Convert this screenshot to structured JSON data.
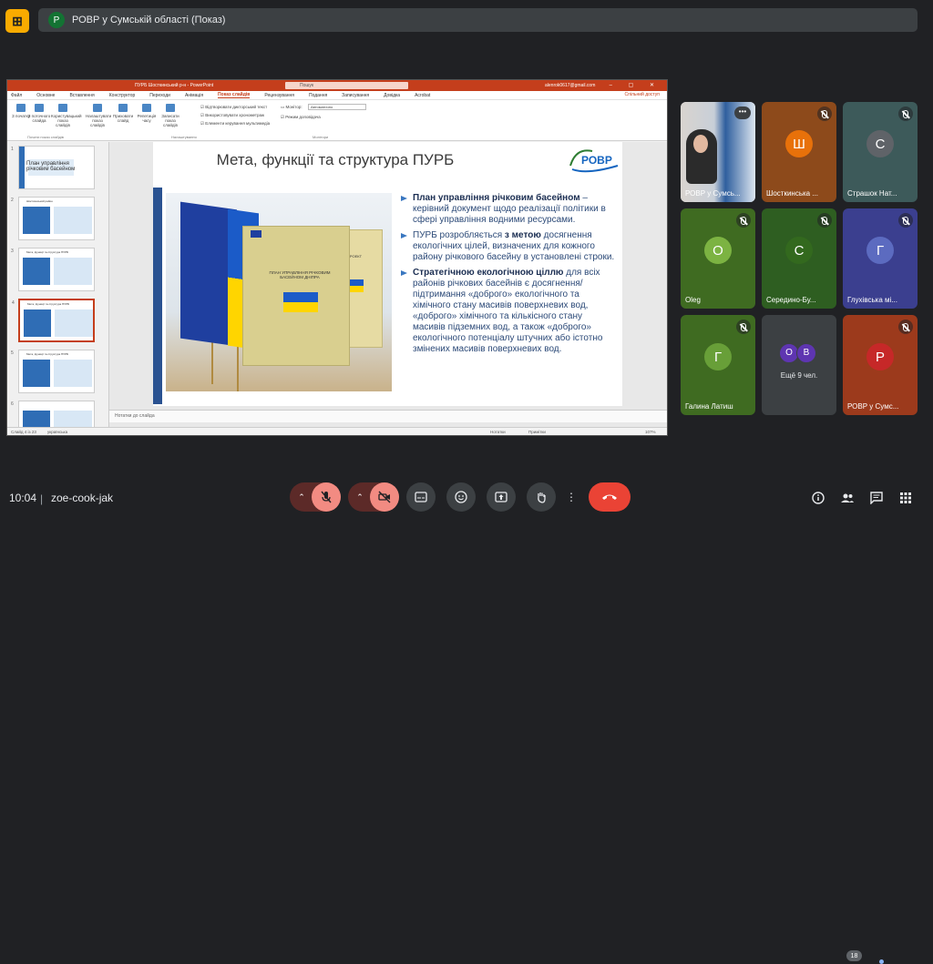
{
  "meeting": {
    "title": "РОВР у Сумській області (Показ)",
    "presenter_initial": "Р",
    "time": "10:04",
    "separator": "|",
    "code": "zoe-cook-jak",
    "participant_count": "18"
  },
  "powerpoint": {
    "doc_title": "ПУРБ Шосткинський р-н - PowerPoint",
    "search_placeholder": "Пошук",
    "user": "alenrok0617@gmail.com",
    "window_controls": "– ▢ ✕",
    "menu": [
      "Файл",
      "Основне",
      "Вставлення",
      "Конструктор",
      "Переходи",
      "Анімація",
      "Показ слайдів",
      "Рецензування",
      "Подання",
      "Записування",
      "Довідка",
      "Acrobat"
    ],
    "active_menu_index": 6,
    "share": "Спільний доступ",
    "ribbon": {
      "buttons": [
        "З початку",
        "З поточного слайда",
        "Користувацький показ слайдів",
        "Налаштувати показ слайдів",
        "Приховати слайд",
        "Репетиція часу",
        "Записати показ слайдів"
      ],
      "checks": [
        "Відтворювати дикторський текст",
        "Використовувати хронометраж",
        "Елементи керування мультимедіа"
      ],
      "monitor_label": "Монітор:",
      "monitor_value": "Автоматично",
      "presenter_view": "Режим доповідача",
      "groups": [
        "Почати показ слайдів",
        "Налаштування",
        "Монітори"
      ]
    },
    "thumbnails": [
      {
        "num": "1",
        "title": "План управління річковим басейном"
      },
      {
        "num": "2",
        "title": "Шосткинський район"
      },
      {
        "num": "3",
        "title": "Мета, функції та структура ПУРБ"
      },
      {
        "num": "4",
        "title": "Мета, функції та структура ПУРБ"
      },
      {
        "num": "5",
        "title": "Мета, функції та структура ПУРБ"
      },
      {
        "num": "6",
        "title": ""
      }
    ],
    "selected_thumbnail": 3,
    "notes": "Нотатки до слайда",
    "status": {
      "slide": "Слайд 4 із 23",
      "lang": "українська",
      "notes_btn": "Нотатки",
      "comments_btn": "Примітки",
      "zoom": "107%"
    }
  },
  "slide": {
    "title": "Мета, функції та структура ПУРБ",
    "logo_text": "РОВР",
    "logo_sub": "у Сумській області",
    "book_caption": "ПЛАН УПРАВЛІННЯ РІЧКОВИМ БАСЕЙНОМ ДНІПРА",
    "book2_caption": "ПРОЕКТ",
    "bullets": [
      {
        "bold": "План управління річковим басейном",
        "text": " – керівний документ щодо реалізації політики в сфері управління водними ресурсами."
      },
      {
        "pre": "ПУРБ розробляється ",
        "bold": "з метою",
        "text": " досягнення екологічних цілей, визначених для кожного району річкового басейну в установлені строки."
      },
      {
        "bold": "Стратегічною екологічною ціллю",
        "text": " для всіх районів річкових басейнів є досягнення/підтримання «доброго» екологічного та хімічного стану масивів поверхневих вод, «доброго» хімічного та кількісного стану масивів підземних вод, а також «доброго» екологічного потенціалу штучних або істотно змінених масивів поверхневих вод."
      }
    ]
  },
  "participants": [
    {
      "name": "РОВР у Сумсь...",
      "initial": "",
      "color": "#5b7fa8",
      "muted": false,
      "video": true
    },
    {
      "name": "Шосткинська ...",
      "initial": "Ш",
      "color": "#e8710a",
      "bg": "#8d4a1b",
      "muted": true
    },
    {
      "name": "Страшок Нат...",
      "initial": "С",
      "color": "#5f6368",
      "bg": "#3d5a5a",
      "muted": true
    },
    {
      "name": "Oleg",
      "initial": "О",
      "color": "#7cb342",
      "bg": "#3f6b21",
      "muted": true
    },
    {
      "name": "Середино-Бу...",
      "initial": "С",
      "color": "#33691e",
      "bg": "#2e5e21",
      "muted": true
    },
    {
      "name": "Глухівська мі...",
      "initial": "Г",
      "color": "#5c6bc0",
      "bg": "#3b3f8f",
      "muted": true
    },
    {
      "name": "Галина Латиш",
      "initial": "Г",
      "color": "#689f38",
      "bg": "#3f6b21",
      "muted": true
    },
    {
      "name": "Ещё 9 чел.",
      "others": true
    },
    {
      "name": "РОВР у Сумс...",
      "initial": "Р",
      "color": "#c62828",
      "bg": "#9c3a1c",
      "muted": true
    }
  ],
  "more_avatars": [
    {
      "l": "О",
      "c": "#5e35b1"
    },
    {
      "l": "В",
      "c": "#5e35b1"
    }
  ],
  "colors": {
    "accent_red": "#ea4335",
    "muted_btn": "#f28b82",
    "ppt_red": "#c43e1c"
  },
  "icons": {
    "mic": "mic-off-icon",
    "cam": "camera-off-icon",
    "cc": "captions-icon",
    "emoji": "emoji-icon",
    "present": "present-icon",
    "hand": "raise-hand-icon",
    "more": "more-vert-icon",
    "end": "end-call-icon",
    "info": "info-icon",
    "people": "people-icon",
    "chat": "chat-icon",
    "activities": "apps-icon"
  }
}
